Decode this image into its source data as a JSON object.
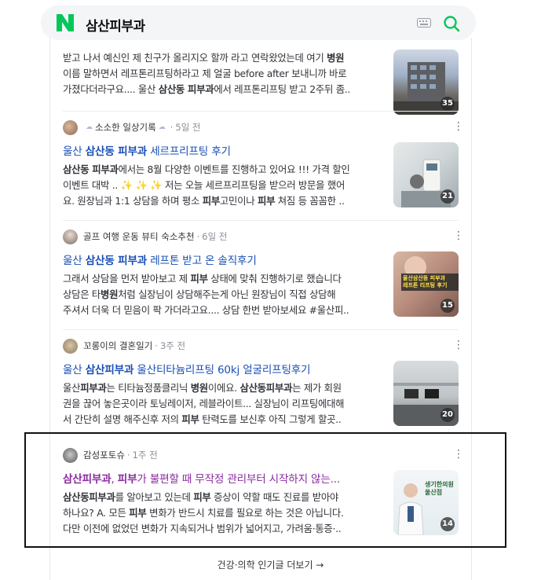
{
  "search": {
    "query": "삼산피부과"
  },
  "items": [
    {
      "desc_lines": [
        [
          {
            "t": "받고 나서 예신인 제 친구가 올리지오 할까 라고 연락왔었는데 여기 "
          },
          {
            "t": "병원",
            "b": true
          }
        ],
        [
          {
            "t": "이름 말하면서 레프톤리프팅하라고 제 얼굴 before after 보내니까 바로"
          }
        ],
        [
          {
            "t": "가졌다더라구요.... 울산 "
          },
          {
            "t": "삼산동 피부과",
            "b": true
          },
          {
            "t": "에서 레프톤리프팅 받고 2주뒤 좀.."
          }
        ]
      ],
      "badge": "35"
    },
    {
      "author": "소소한 일상기록",
      "time": "5일 전",
      "title": [
        {
          "t": "울산 "
        },
        {
          "t": "삼산동 피부과",
          "b": true
        },
        {
          "t": " 세르프리프팅 후기"
        }
      ],
      "desc_lines": [
        [
          {
            "t": "삼산동 피부과",
            "b": true
          },
          {
            "t": "에서는 8월 다양한 이벤트를 진행하고 있어요 !!! 가격 할인"
          }
        ],
        [
          {
            "t": "이벤트 대박 .. ✨ ✨ ✨ 저는 오늘 세르프리프팅을 받으러 방문을 했어"
          }
        ],
        [
          {
            "t": "요. 원장님과 1:1 상담을 하며 평소 "
          },
          {
            "t": "피부",
            "b": true
          },
          {
            "t": "고민이나 "
          },
          {
            "t": "피부",
            "b": true
          },
          {
            "t": " 쳐짐 등 꼼꼼한 .."
          }
        ]
      ],
      "badge": "21"
    },
    {
      "author": "골프 여행 운동 뷰티 숙소추천",
      "time": "6일 전",
      "title": [
        {
          "t": "울산 "
        },
        {
          "t": "삼산동 피부과",
          "b": true
        },
        {
          "t": " 레프톤 받고 온 솔직후기"
        }
      ],
      "desc_lines": [
        [
          {
            "t": "그래서 상담을 먼저 받아보고 제 "
          },
          {
            "t": "피부",
            "b": true
          },
          {
            "t": " 상태에 맞춰 진행하기로 했습니다"
          }
        ],
        [
          {
            "t": "상담은 타"
          },
          {
            "t": "병원",
            "b": true
          },
          {
            "t": "처럼 실장님이 상담해주는게 아닌 원장님이 직접 상담해"
          }
        ],
        [
          {
            "t": "주셔서 더욱 더 믿음이 팍 가더라고요.... 상담 한번 받아보세요 #울산피.."
          }
        ]
      ],
      "thumb_text": "울산삼산동 피부과\n레프톤 리프팅 후기",
      "badge": "15"
    },
    {
      "author": "꼬롱이의 결혼일기",
      "time": "3주 전",
      "title": [
        {
          "t": "울산 "
        },
        {
          "t": "삼산피부과",
          "b": true
        },
        {
          "t": " 울산티타늄리프팅 60kj 얼굴리프팅후기"
        }
      ],
      "desc_lines": [
        [
          {
            "t": "울산"
          },
          {
            "t": "피부과",
            "b": true
          },
          {
            "t": "는 티타늄정품클리닉 "
          },
          {
            "t": "병원",
            "b": true
          },
          {
            "t": "이에요. "
          },
          {
            "t": "삼산동피부과",
            "b": true
          },
          {
            "t": "는 제가 회원"
          }
        ],
        [
          {
            "t": "권을 끊어 놓은곳이라 토닝레이저, 레블라이트... 실장님이 리프팅에대해"
          }
        ],
        [
          {
            "t": "서 간단히 설명 해주신후 저의 "
          },
          {
            "t": "피부",
            "b": true
          },
          {
            "t": " 탄력도를 보신후 아직 그렇게 할곳.."
          }
        ]
      ],
      "badge": "20"
    },
    {
      "author": "감성포토슈",
      "time": "1주 전",
      "title": [
        {
          "t": "삼산피부과",
          "b": true
        },
        {
          "t": ", "
        },
        {
          "t": "피부",
          "b": true
        },
        {
          "t": "가 불편할 때 무작정 관리부터 시작하지 않는..."
        }
      ],
      "desc_lines": [
        [
          {
            "t": "삼산동피부과",
            "b": true
          },
          {
            "t": "를 알아보고 있는데 "
          },
          {
            "t": "피부",
            "b": true
          },
          {
            "t": " 증상이 약할 때도 진료를 받아야"
          }
        ],
        [
          {
            "t": "하나요? A. 모든 "
          },
          {
            "t": "피부",
            "b": true
          },
          {
            "t": " 변화가 반드시 치료를 필요로 하는 것은 아닙니다."
          }
        ],
        [
          {
            "t": "다만 이전에 없었던 변화가 지속되거나 범위가 넓어지고, 가려움·통증·.."
          }
        ]
      ],
      "thumb_text": "생기한의원\n울산점",
      "badge": "14"
    }
  ],
  "footer": {
    "label": "건강·의학 인기글 더보기 →"
  },
  "colors": {
    "link": "#1a4fb6",
    "visited": "#8a2aa0",
    "brand_green": "#03c75a"
  }
}
